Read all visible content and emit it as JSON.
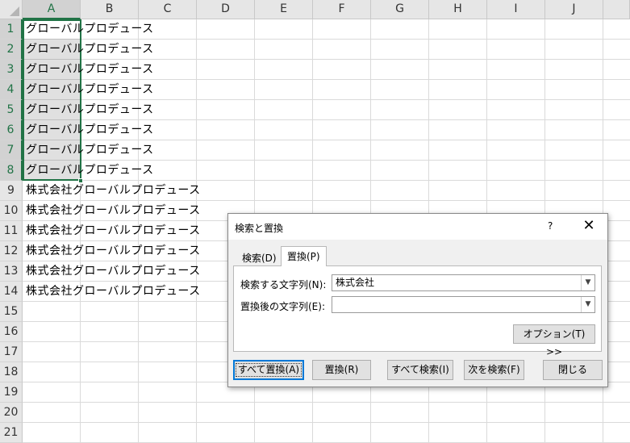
{
  "sheet": {
    "columns": [
      "A",
      "B",
      "C",
      "D",
      "E",
      "F",
      "G",
      "H",
      "I",
      "J"
    ],
    "rows": [
      "1",
      "2",
      "3",
      "4",
      "5",
      "6",
      "7",
      "8",
      "9",
      "10",
      "11",
      "12",
      "13",
      "14",
      "15",
      "16",
      "17",
      "18",
      "19",
      "20",
      "21"
    ],
    "cells_a": [
      "グローバルプロデュース",
      "グローバルプロデュース",
      "グローバルプロデュース",
      "グローバルプロデュース",
      "グローバルプロデュース",
      "グローバルプロデュース",
      "グローバルプロデュース",
      "グローバルプロデュース",
      "株式会社グローバルプロデュース",
      "株式会社グローバルプロデュース",
      "株式会社グローバルプロデュース",
      "株式会社グローバルプロデュース",
      "株式会社グローバルプロデュース",
      "株式会社グローバルプロデュース"
    ],
    "selected_column": "A",
    "selected_rows": "1-8",
    "accent_color": "#217346"
  },
  "dialog": {
    "title": "検索と置換",
    "help": "?",
    "close": "✕",
    "tabs": {
      "search": "検索(D)",
      "replace": "置換(P)"
    },
    "find_label": "検索する文字列(N):",
    "find_value": "株式会社",
    "replace_label": "置換後の文字列(E):",
    "replace_value": "",
    "options_button": "オプション(T) >>",
    "buttons": {
      "replace_all": "すべて置換(A)",
      "replace": "置換(R)",
      "find_all": "すべて検索(I)",
      "find_next": "次を検索(F)",
      "close": "閉じる"
    }
  }
}
